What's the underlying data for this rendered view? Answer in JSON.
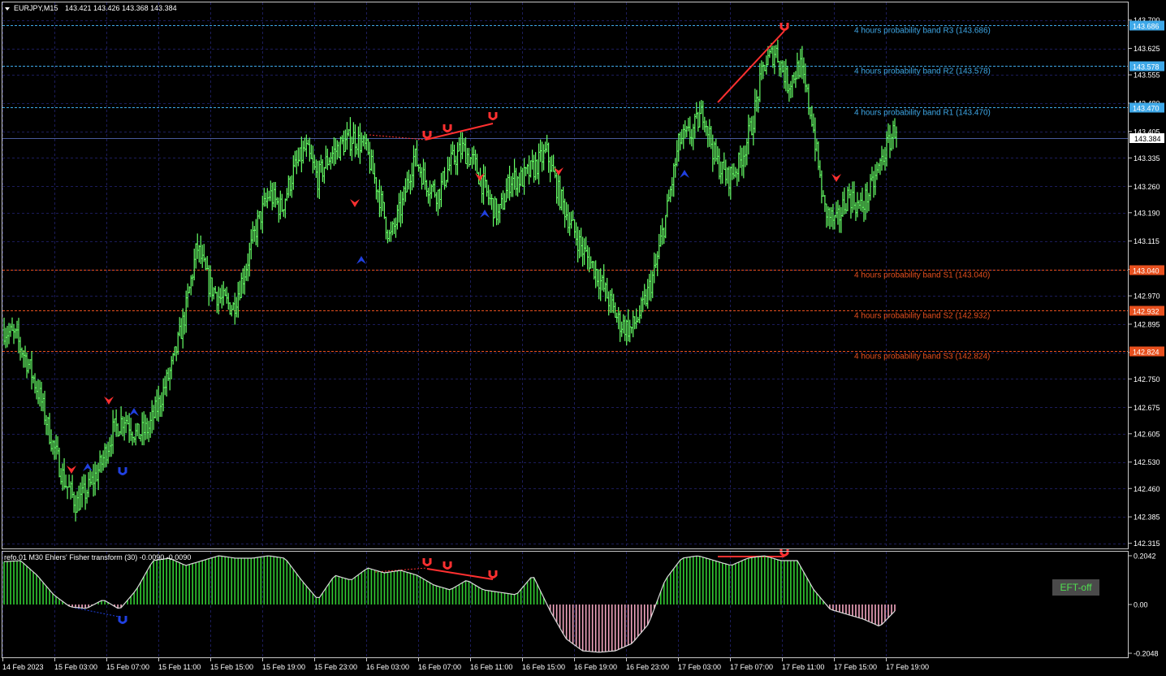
{
  "header": {
    "symbol_timeframe": "EURJPY,M15",
    "ohlc": "143.421 143.426 143.368 143.384"
  },
  "indicator": {
    "label": "refo.01 M30 Ehlers' Fisher transform (30) -0.0090 -0.0090",
    "button_label": "EFT-off",
    "y_ticks": [
      "0.2042",
      "0.00",
      "-0.2048"
    ]
  },
  "price_axis": {
    "ticks": [
      "143.700",
      "143.625",
      "143.555",
      "143.480",
      "143.405",
      "143.335",
      "143.260",
      "143.190",
      "143.115",
      "143.040",
      "142.970",
      "142.895",
      "142.820",
      "142.750",
      "142.675",
      "142.605",
      "142.530",
      "142.460",
      "142.385",
      "142.315"
    ],
    "current_price": "143.384"
  },
  "bands": [
    {
      "label": "4 hours probability band R3 (143.686)",
      "tag": "143.686",
      "value": 143.686,
      "color": "#3ea8e8"
    },
    {
      "label": "4 hours probability band R2 (143.578)",
      "tag": "143.578",
      "value": 143.578,
      "color": "#3ea8e8"
    },
    {
      "label": "4 hours probability band R1 (143.470)",
      "tag": "143.470",
      "value": 143.47,
      "color": "#3ea8e8"
    },
    {
      "label": "4 hours probability band S1 (143.040)",
      "tag": "143.040",
      "value": 143.04,
      "color": "#e8501e"
    },
    {
      "label": "4 hours probability band S2 (142.932)",
      "tag": "142.932",
      "value": 142.932,
      "color": "#e8501e"
    },
    {
      "label": "4 hours probability band S3 (142.824)",
      "tag": "142.824",
      "value": 142.824,
      "color": "#e8501e"
    }
  ],
  "time_axis": [
    "14 Feb 2023",
    "15 Feb 03:00",
    "15 Feb 07:00",
    "15 Feb 11:00",
    "15 Feb 15:00",
    "15 Feb 19:00",
    "15 Feb 23:00",
    "16 Feb 03:00",
    "16 Feb 07:00",
    "16 Feb 11:00",
    "16 Feb 15:00",
    "16 Feb 19:00",
    "16 Feb 23:00",
    "17 Feb 03:00",
    "17 Feb 07:00",
    "17 Feb 11:00",
    "17 Feb 15:00",
    "17 Feb 19:00"
  ],
  "colors": {
    "bullish": "#32cd32",
    "up_bar": "#66ff66",
    "bearish": "#ff3030",
    "fisher_neg": "#f4a6c0",
    "grid": "#1c1c5a",
    "current_price_line": "#4a5a9a"
  },
  "chart_data": {
    "type": "line",
    "series": [
      {
        "name": "EURJPY,M15",
        "values": [
          142.88,
          142.86,
          142.79,
          142.7,
          142.58,
          142.48,
          142.42,
          142.46,
          142.52,
          142.61,
          142.65,
          142.6,
          142.62,
          142.7,
          142.79,
          142.92,
          143.1,
          143.0,
          142.96,
          142.94,
          143.04,
          143.16,
          143.24,
          143.2,
          143.3,
          143.36,
          143.28,
          143.34,
          143.37,
          143.39,
          143.36,
          143.25,
          143.12,
          143.21,
          143.34,
          143.27,
          143.24,
          143.32,
          143.36,
          143.32,
          143.24,
          143.18,
          143.28,
          143.28,
          143.31,
          143.35,
          143.24,
          143.16,
          143.09,
          143.04,
          142.97,
          142.9,
          142.88,
          142.94,
          143.04,
          143.2,
          143.38,
          143.4,
          143.46,
          143.33,
          143.28,
          143.32,
          143.42,
          143.58,
          143.62,
          143.53,
          143.58,
          143.44,
          143.2,
          143.16,
          143.24,
          143.2,
          143.26,
          143.35,
          143.42
        ]
      }
    ],
    "ylim": [
      142.31,
      143.71
    ]
  }
}
